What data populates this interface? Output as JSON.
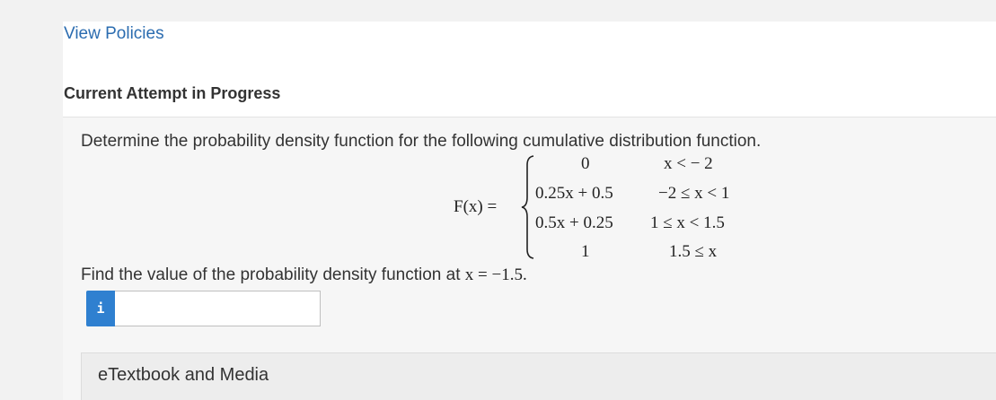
{
  "header": {
    "view_policies": "View Policies",
    "attempt_title": "Current Attempt in Progress"
  },
  "question": {
    "prompt": "Determine the probability density function for the following cumulative distribution function.",
    "function_name": "F(x)",
    "equals": "=",
    "cases": [
      {
        "value": "0",
        "condition": "x <  − 2"
      },
      {
        "value": "0.25x + 0.5",
        "condition": "−2 ≤ x < 1"
      },
      {
        "value": "0.5x + 0.25",
        "condition": "1 ≤ x < 1.5"
      },
      {
        "value": "1",
        "condition": "1.5 ≤ x"
      }
    ],
    "find_prefix": "Find the value of the probability density function at ",
    "find_math": "x = −1.5."
  },
  "answer": {
    "info_icon_label": "i",
    "value": ""
  },
  "resources": {
    "etextbook_label": "eTextbook and Media"
  },
  "colors": {
    "link": "#2b6cb0",
    "info_button": "#2f80d0"
  }
}
